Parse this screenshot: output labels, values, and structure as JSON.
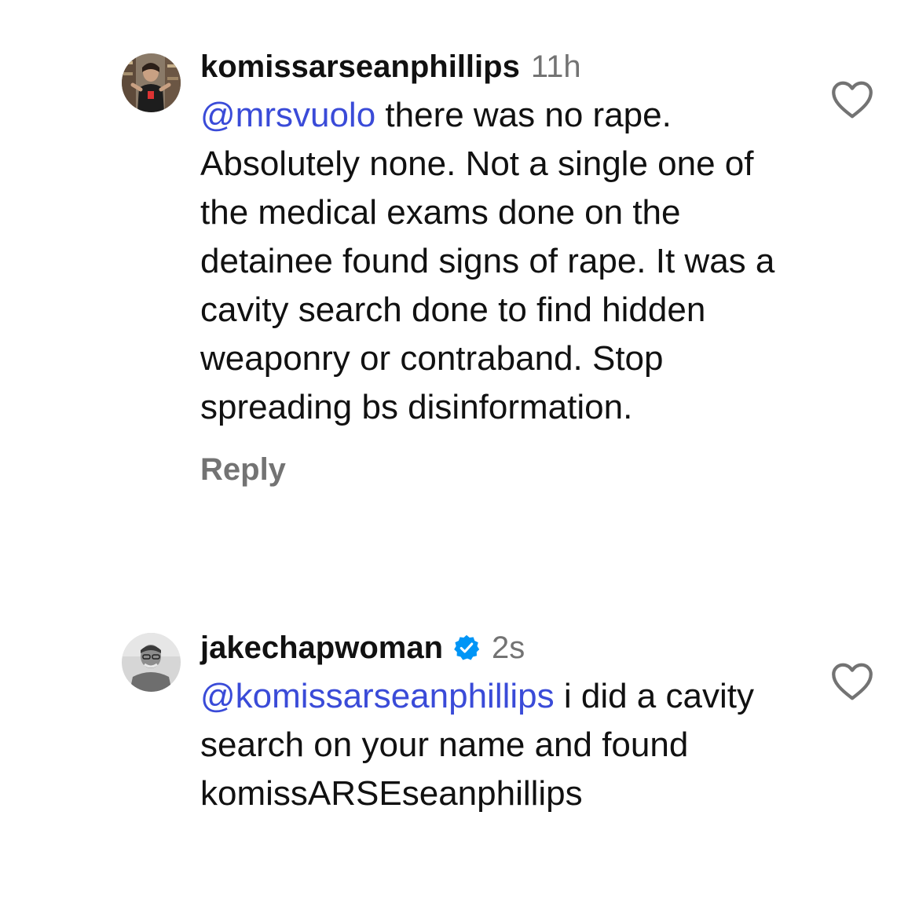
{
  "comments": [
    {
      "username": "komissarseanphillips",
      "time": "11h",
      "verified": false,
      "mention": "@mrsvuolo",
      "text": " there was no rape. Absolutely none. Not a single one of the medical exams done on the detainee found signs of rape. It was a cavity search done to find hidden weaponry or contraband. Stop spreading bs disinformation.",
      "reply_label": "Reply",
      "avatar_icon": "avatar-photo-man-bookshelf",
      "like_icon": "heart-outline-icon"
    },
    {
      "username": "jakechapwoman",
      "time": "2s",
      "verified": true,
      "verified_icon": "verified-badge-icon",
      "mention": "@komissarseanphillips",
      "text": " i did a cavity search on your name and found komissARSEseanphillips",
      "avatar_icon": "avatar-photo-grey-man",
      "like_icon": "heart-outline-icon"
    }
  ],
  "colors": {
    "mention": "#3a4bd8",
    "secondary_text": "#737373",
    "verified_blue": "#0095f6",
    "primary_text": "#111111"
  }
}
